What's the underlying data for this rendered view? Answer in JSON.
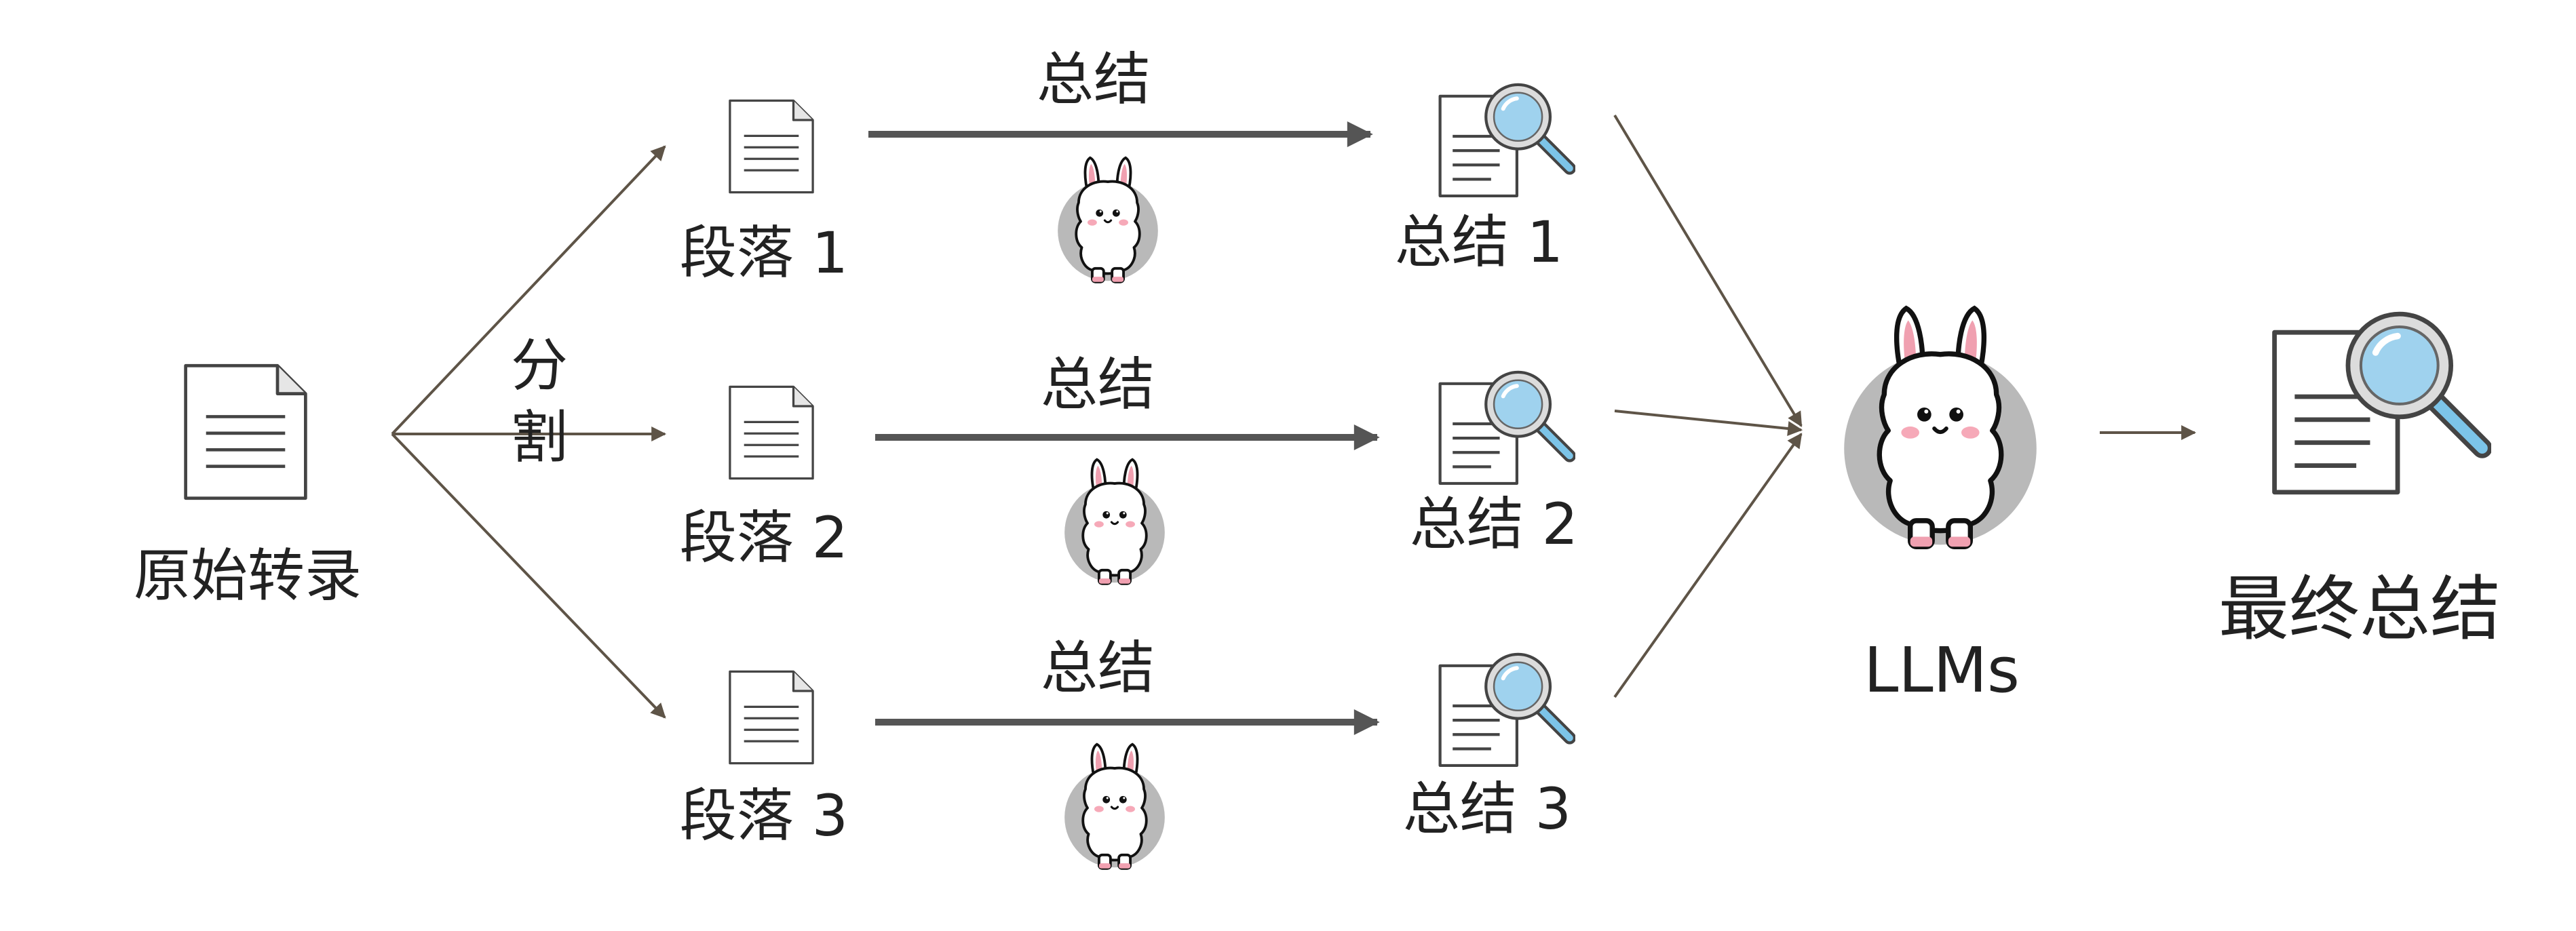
{
  "nodes": {
    "source": {
      "label": "原始转录",
      "icon": "document-icon"
    },
    "split": {
      "label_line1": "分",
      "label_line2": "割"
    },
    "segments": [
      {
        "label": "段落 1",
        "icon": "document-icon"
      },
      {
        "label": "段落 2",
        "icon": "document-icon"
      },
      {
        "label": "段落 3",
        "icon": "document-icon"
      }
    ],
    "summarize_edges": [
      {
        "label": "总结",
        "icon": "llama-icon"
      },
      {
        "label": "总结",
        "icon": "llama-icon"
      },
      {
        "label": "总结",
        "icon": "llama-icon"
      }
    ],
    "summaries": [
      {
        "label": "总结 1",
        "icon": "document-search-icon"
      },
      {
        "label": "总结 2",
        "icon": "document-search-icon"
      },
      {
        "label": "总结 3",
        "icon": "document-search-icon"
      }
    ],
    "llm": {
      "label": "LLMs",
      "icon": "llama-icon"
    },
    "final": {
      "label": "最终总结",
      "icon": "document-search-icon"
    }
  },
  "colors": {
    "thin_arrow": "#5e5447",
    "thick_arrow": "#555555",
    "doc_stroke": "#444444",
    "lens_blue": "#9fd2ee",
    "llama_body": "#ffffff",
    "llama_ear": "#f0a0b0",
    "halo": "#b9b9b9"
  }
}
